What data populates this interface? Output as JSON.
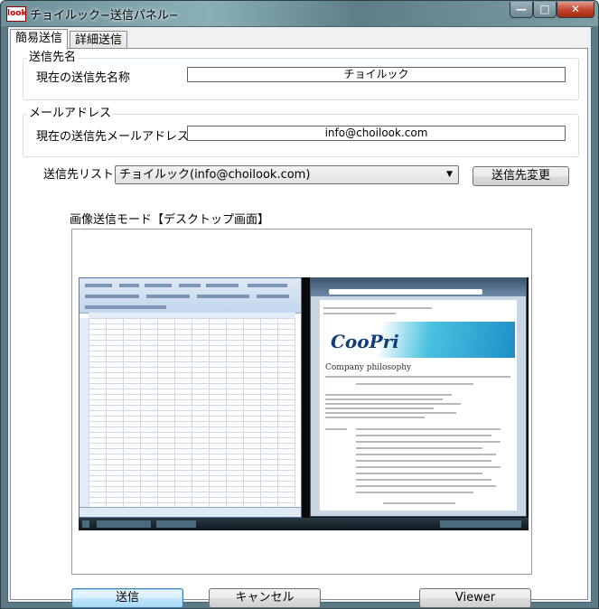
{
  "window": {
    "title": "チョイルック−送信パネル−",
    "app_icon_text": "look",
    "minimize_glyph": "—",
    "maximize_glyph": "□",
    "close_glyph": "✕"
  },
  "tabs": [
    {
      "label": "簡易送信",
      "active": true
    },
    {
      "label": "詳細送信",
      "active": false
    }
  ],
  "recipient_name_group": {
    "legend": "送信先名",
    "label": "現在の送信先名称",
    "value": "チョイルック"
  },
  "email_group": {
    "legend": "メールアドレス",
    "label": "現在の送信先メールアドレス",
    "value": "info@choilook.com"
  },
  "recipient_list": {
    "label": "送信先リスト",
    "selected": "チョイルック(info@choilook.com)",
    "change_button": "送信先変更"
  },
  "preview": {
    "label": "画像送信モード【デスクトップ画面】",
    "screenshot_brand": "CooPri",
    "screenshot_heading": "Company philosophy"
  },
  "buttons": {
    "send": "送信",
    "cancel": "キャンセル",
    "viewer": "Viewer"
  },
  "colors": {
    "title_bar": "#7e9ea6",
    "close_button": "#c0412a",
    "default_button_border": "#3c7fb1"
  }
}
